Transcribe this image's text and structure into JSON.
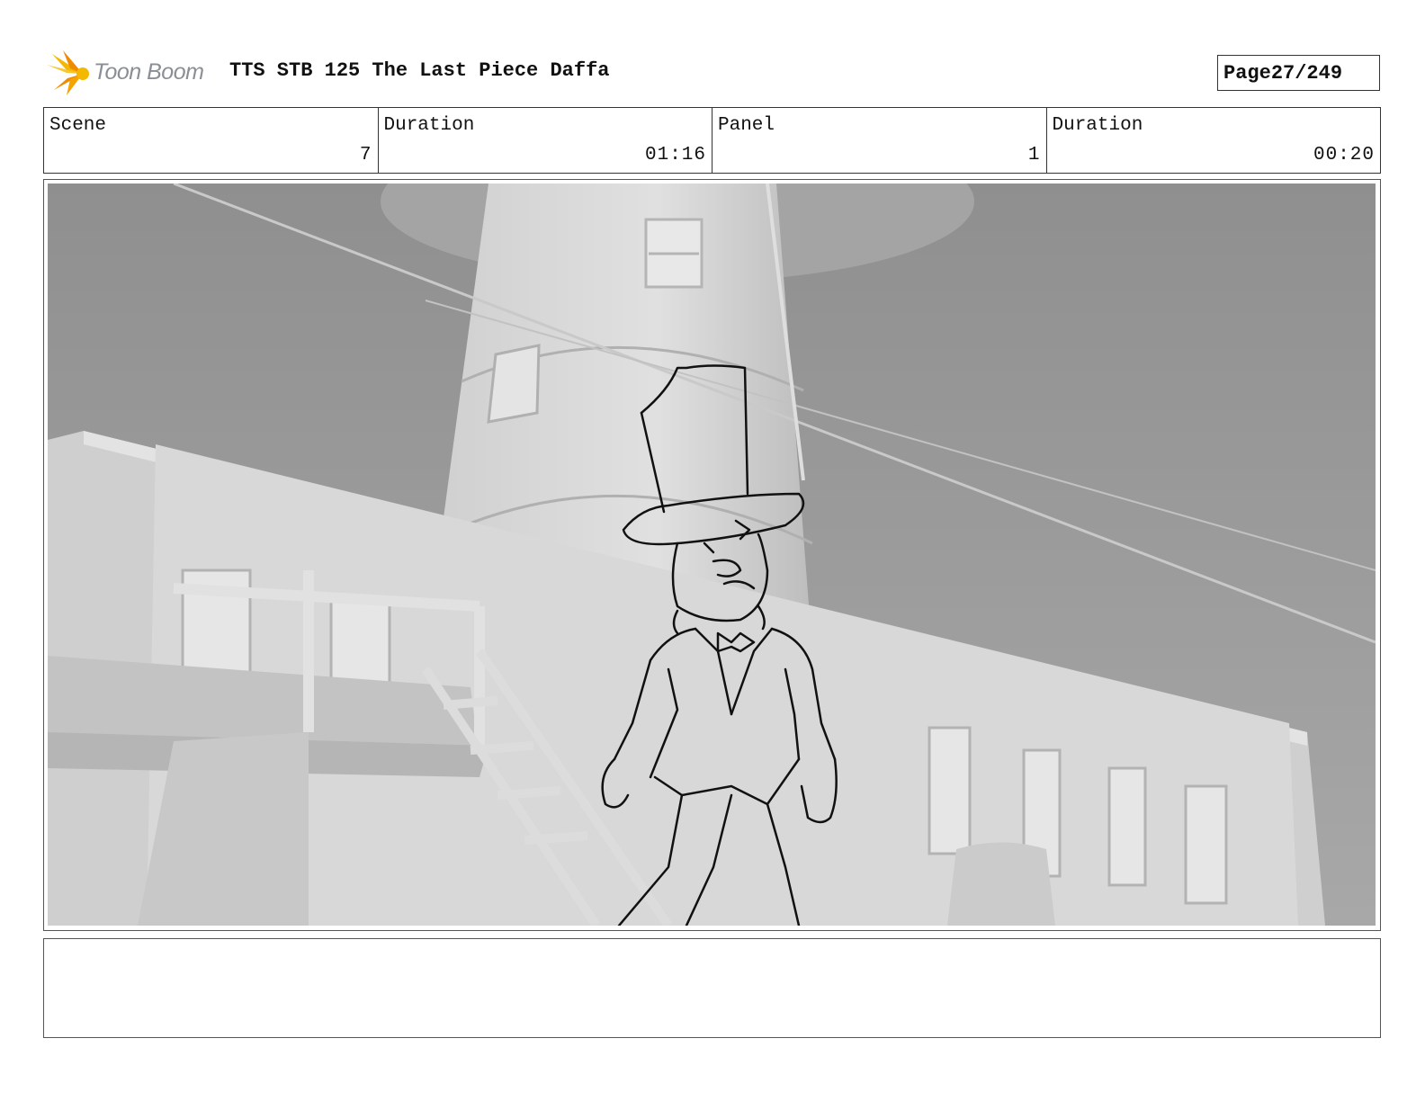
{
  "header": {
    "logo_text": "Toon Boom",
    "title": "TTS STB 125 The Last Piece Daffa",
    "page_label": "Page",
    "page_value": "27/249"
  },
  "info": {
    "scene_label": "Scene",
    "scene_value": "7",
    "scene_duration_label": "Duration",
    "scene_duration_value": "01:16",
    "panel_label": "Panel",
    "panel_value": "1",
    "panel_duration_label": "Duration",
    "panel_duration_value": "00:20"
  },
  "panel": {
    "image_subject": "storyboard-sketch-character-top-hat-lighthouse"
  },
  "notes": {
    "text": ""
  },
  "colors": {
    "logo_yellow": "#f5b800",
    "logo_orange": "#f08a00",
    "logo_text": "#8a8f96",
    "sky": "#9c9c9c",
    "building": "#d4d4d4"
  }
}
